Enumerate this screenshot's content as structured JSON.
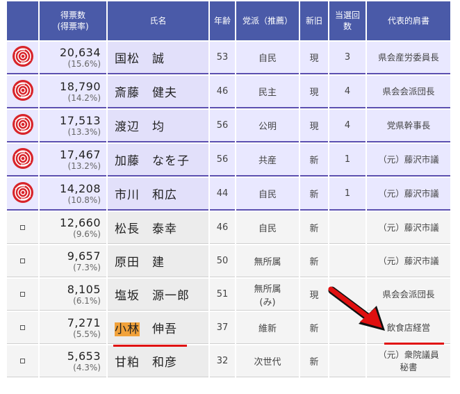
{
  "headers": {
    "votes": "得票数\n(得票率)",
    "name": "氏名",
    "age": "年齢",
    "party": "党派（推薦）",
    "status": "新旧",
    "times": "当選回\n数",
    "title": "代表的肩書"
  },
  "rows": [
    {
      "votes": "20,634",
      "rate": "(15.6%)",
      "name_a": "国松",
      "name_b": "誠",
      "age": "53",
      "party": "自民",
      "party2": "",
      "status": "現",
      "times": "3",
      "title": "県会産労委員長",
      "title2": ""
    },
    {
      "votes": "18,790",
      "rate": "(14.2%)",
      "name_a": "斎藤",
      "name_b": "健夫",
      "age": "46",
      "party": "民主",
      "party2": "",
      "status": "現",
      "times": "4",
      "title": "県会会派団長",
      "title2": ""
    },
    {
      "votes": "17,513",
      "rate": "(13.3%)",
      "name_a": "渡辺",
      "name_b": "均",
      "age": "56",
      "party": "公明",
      "party2": "",
      "status": "現",
      "times": "4",
      "title": "党県幹事長",
      "title2": ""
    },
    {
      "votes": "17,467",
      "rate": "(13.2%)",
      "name_a": "加藤",
      "name_b": "なを子",
      "age": "56",
      "party": "共産",
      "party2": "",
      "status": "新",
      "times": "1",
      "title": "（元）藤沢市議",
      "title2": ""
    },
    {
      "votes": "14,208",
      "rate": "(10.8%)",
      "name_a": "市川",
      "name_b": "和広",
      "age": "44",
      "party": "自民",
      "party2": "",
      "status": "新",
      "times": "1",
      "title": "（元）藤沢市議",
      "title2": ""
    },
    {
      "votes": "12,660",
      "rate": "(9.6%)",
      "name_a": "松長",
      "name_b": "泰幸",
      "age": "46",
      "party": "自民",
      "party2": "",
      "status": "新",
      "times": "",
      "title": "（元）藤沢市議",
      "title2": ""
    },
    {
      "votes": "9,657",
      "rate": "(7.3%)",
      "name_a": "原田",
      "name_b": "建",
      "age": "50",
      "party": "無所属",
      "party2": "",
      "status": "新",
      "times": "",
      "title": "（元）藤沢市議",
      "title2": ""
    },
    {
      "votes": "8,105",
      "rate": "(6.1%)",
      "name_a": "塩坂",
      "name_b": "源一郎",
      "age": "51",
      "party": "無所属",
      "party2": "(み)",
      "status": "現",
      "times": "",
      "title": "県会会派団長",
      "title2": ""
    },
    {
      "votes": "7,271",
      "rate": "(5.5%)",
      "name_a": "小林",
      "name_b": "伸吾",
      "age": "37",
      "party": "維新",
      "party2": "",
      "status": "新",
      "times": "",
      "title": "飲食店経営",
      "title2": ""
    },
    {
      "votes": "5,653",
      "rate": "(4.3%)",
      "name_a": "甘粕",
      "name_b": "和彦",
      "age": "32",
      "party": "次世代",
      "party2": "",
      "status": "新",
      "times": "",
      "title": "（元）衆院議員",
      "title2": "秘書"
    }
  ],
  "elected_count": 5,
  "highlight_row": 8,
  "colors": {
    "header": "#4a5aa8",
    "elected_bg": "#e9e8ff",
    "accent": "#e01010",
    "highlight": "#f2a23a"
  },
  "icons": {
    "elected": "rose-icon",
    "not_elected": "square-icon",
    "annotation": "red-arrow-icon"
  }
}
